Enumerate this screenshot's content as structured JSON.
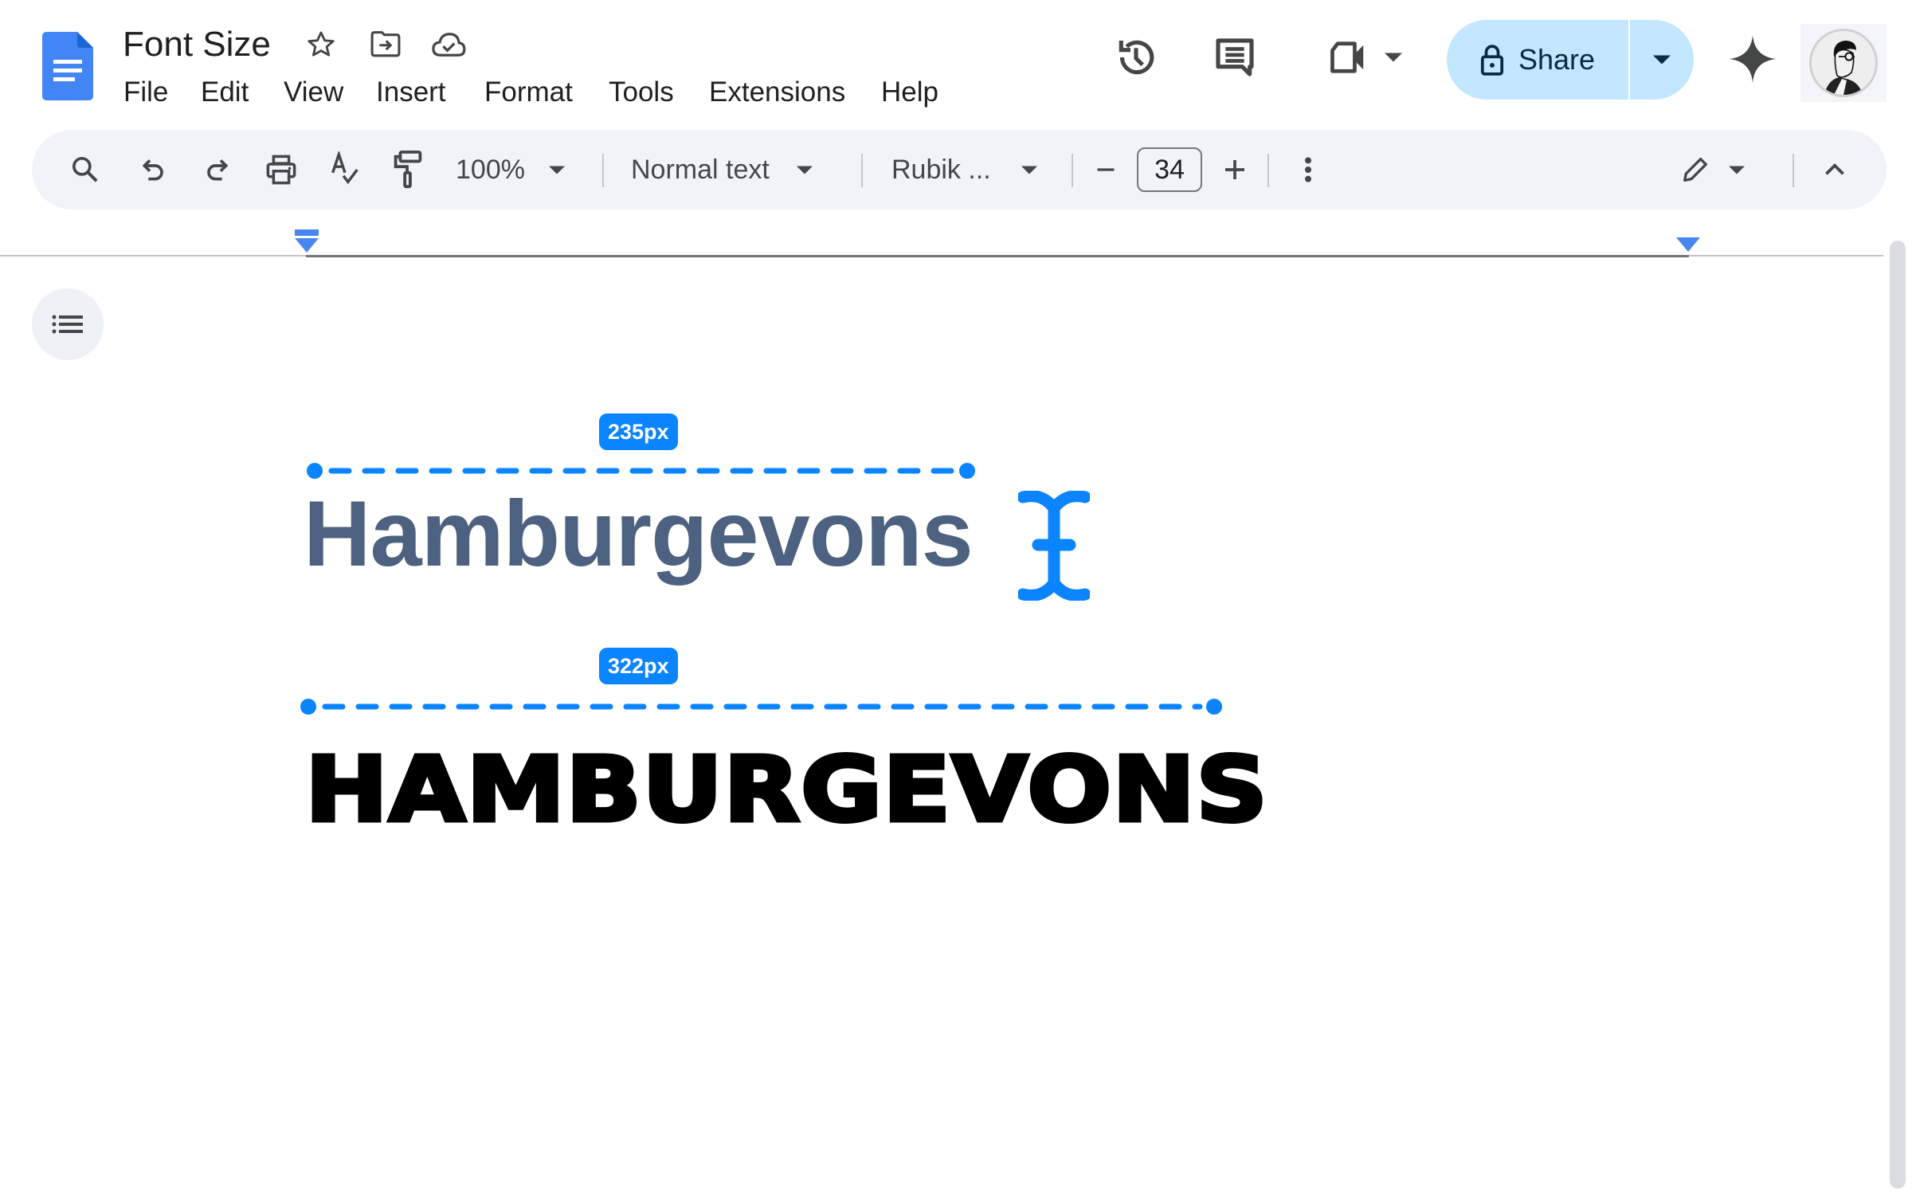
{
  "app": {
    "doc_title": "Font Size",
    "title_icons": [
      "star-icon",
      "move-to-folder-icon",
      "cloud-saved-icon"
    ]
  },
  "menu": [
    "File",
    "Edit",
    "View",
    "Insert",
    "Format",
    "Tools",
    "Extensions",
    "Help"
  ],
  "header_actions": {
    "history_icon": "version-history-icon",
    "comments_icon": "comments-icon",
    "meet_icon": "video-call-icon",
    "share_label": "Share",
    "gemini_icon": "sparkle-icon",
    "avatar": "account-avatar"
  },
  "toolbar": {
    "zoom": "100%",
    "style": "Normal text",
    "font": "Rubik ...",
    "font_size": "34",
    "decrease_label": "−",
    "increase_label": "+"
  },
  "measurements": [
    {
      "label": "235px",
      "text": "Hamburgevons"
    },
    {
      "label": "322px",
      "text": "HAMBURGEVONS"
    }
  ],
  "colors": {
    "accent": "#0a84ff",
    "share_bg": "#c2e7ff",
    "toolbar_bg": "#f0f4f9",
    "sample1_text": "#4d6180",
    "sample2_text": "#000000",
    "docs_blue": "#4285f4"
  }
}
